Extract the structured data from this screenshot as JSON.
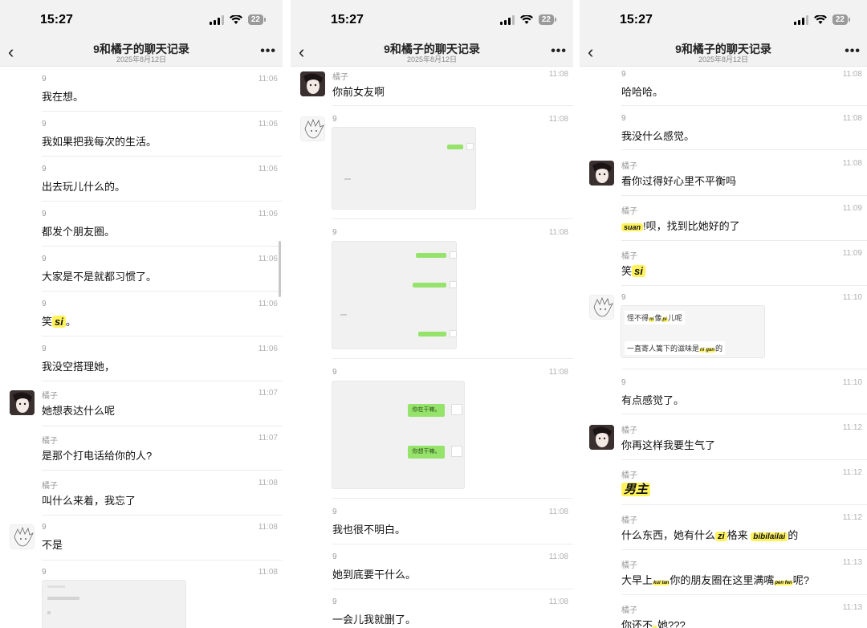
{
  "status": {
    "time": "15:27",
    "battery": "22"
  },
  "header": {
    "title": "9和橘子的聊天记录",
    "date": "2025年8月12日",
    "back_icon": "chevron-left-icon",
    "more_label": "•••"
  },
  "panel1": {
    "messages": [
      {
        "sender": "9",
        "time": "11:06",
        "text": "我在想。"
      },
      {
        "sender": "9",
        "time": "11:06",
        "text": "我如果把我每次的生活。"
      },
      {
        "sender": "9",
        "time": "11:06",
        "text": "出去玩儿什么的。"
      },
      {
        "sender": "9",
        "time": "11:06",
        "text": "都发个朋友圈。"
      },
      {
        "sender": "9",
        "time": "11:06",
        "text": "大家是不是就都习惯了。"
      },
      {
        "sender": "9",
        "time": "11:06",
        "text_pre": "笑",
        "hl": "si",
        "text_post": "。"
      },
      {
        "sender": "9",
        "time": "11:06",
        "text": "我没空搭理她，"
      },
      {
        "sender": "橘子",
        "time": "11:07",
        "text": "她想表达什么呢"
      },
      {
        "sender": "橘子",
        "time": "11:07",
        "text": "是那个打电话给你的人?"
      },
      {
        "sender": "橘子",
        "time": "11:08",
        "text": "叫什么来着，我忘了"
      },
      {
        "sender": "9",
        "time": "11:08",
        "text": "不是"
      },
      {
        "sender": "9",
        "time": "11:08"
      }
    ]
  },
  "panel2": {
    "messages": [
      {
        "sender": "橘子",
        "time": "11:08",
        "text": "你前女友啊"
      },
      {
        "sender": "9",
        "time": "11:08"
      },
      {
        "sender": "9",
        "time": "11:08"
      },
      {
        "sender": "9",
        "time": "11:08",
        "bubbles": [
          "你在干嘛。",
          "你想干嘛。"
        ]
      },
      {
        "sender": "9",
        "time": "11:08",
        "text": "我也很不明白。"
      },
      {
        "sender": "9",
        "time": "11:08",
        "text": "她到底要干什么。"
      },
      {
        "sender": "9",
        "time": "11:08",
        "text": "一会儿我就删了。"
      }
    ]
  },
  "panel3": {
    "messages": [
      {
        "sender": "9",
        "time": "11:08",
        "text": "哈哈哈。"
      },
      {
        "sender": "9",
        "time": "11:08",
        "text": "我没什么感觉。"
      },
      {
        "sender": "橘子",
        "time": "11:08",
        "text": "看你过得好心里不平衡吗"
      },
      {
        "sender": "橘子",
        "time": "11:09",
        "hl": "suan",
        "text_post": "!呗，找到比她好的了"
      },
      {
        "sender": "橘子",
        "time": "11:09",
        "text_pre": "笑",
        "hl": "si"
      },
      {
        "sender": "9",
        "time": "11:10",
        "quote": [
          "怪不得",
          "像",
          "儿呢",
          "一直寄人篱下的滋味是",
          "的"
        ],
        "quote_hl": [
          "ni",
          "pi",
          "ni",
          "gan"
        ]
      },
      {
        "sender": "9",
        "time": "11:10",
        "text": "有点感觉了。"
      },
      {
        "sender": "橘子",
        "time": "11:12",
        "text": "你再这样我要生气了"
      },
      {
        "sender": "橘子",
        "time": "11:12",
        "hl": "男主"
      },
      {
        "sender": "橘子",
        "time": "11:12",
        "text_pre": "什么东西，她有什么",
        "hl": "zi",
        "text_mid": "格来",
        "hl2": "bibilailai",
        "text_post": "的"
      },
      {
        "sender": "橘子",
        "time": "11:13",
        "text_pre": "大早上",
        "hl": "kui tan",
        "text_mid": "你的朋友圈在这里满嘴",
        "hl2": "pen fen",
        "text_post": "呢?"
      },
      {
        "sender": "橘子",
        "time": "11:13",
        "text_pre": "你还不",
        "hl": "",
        "text_post": "她???"
      }
    ]
  }
}
